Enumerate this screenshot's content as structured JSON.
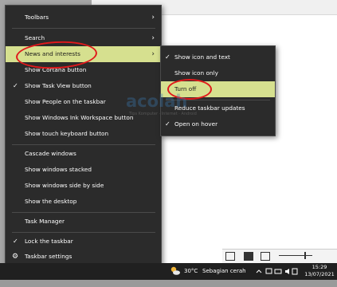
{
  "menu": {
    "items": [
      {
        "label": "Toolbars",
        "arrow": "›"
      },
      {
        "label": "Search",
        "arrow": "›"
      },
      {
        "label": "News and interests",
        "arrow": "›"
      },
      {
        "label": "Show Cortana button"
      },
      {
        "label": "Show Task View button",
        "check": "✓"
      },
      {
        "label": "Show People on the taskbar"
      },
      {
        "label": "Show Windows Ink Workspace button"
      },
      {
        "label": "Show touch keyboard button"
      },
      {
        "label": "Cascade windows"
      },
      {
        "label": "Show windows stacked"
      },
      {
        "label": "Show windows side by side"
      },
      {
        "label": "Show the desktop"
      },
      {
        "label": "Task Manager"
      },
      {
        "label": "Lock the taskbar",
        "check": "✓"
      },
      {
        "label": "Taskbar settings",
        "icon": "gear-icon"
      }
    ]
  },
  "submenu": {
    "items": [
      {
        "label": "Show icon and text",
        "check": "✓"
      },
      {
        "label": "Show icon only"
      },
      {
        "label": "Turn off"
      },
      {
        "label": "Reduce taskbar updates"
      },
      {
        "label": "Open on hover",
        "check": "✓"
      }
    ]
  },
  "taskbar": {
    "weather_icon": "weather-partly-cloudy-icon",
    "temperature": "30°C",
    "condition": "Sebagian cerah",
    "time": "15:29",
    "date": "13/07/2021"
  },
  "watermark": {
    "text": "acolah",
    "tagline": "Tips Komputer · Internet · Android"
  },
  "colors": {
    "menu_bg": "#2b2b2b",
    "highlight": "#d6e08f",
    "annotation": "#e0191b",
    "taskbar": "#202020"
  }
}
